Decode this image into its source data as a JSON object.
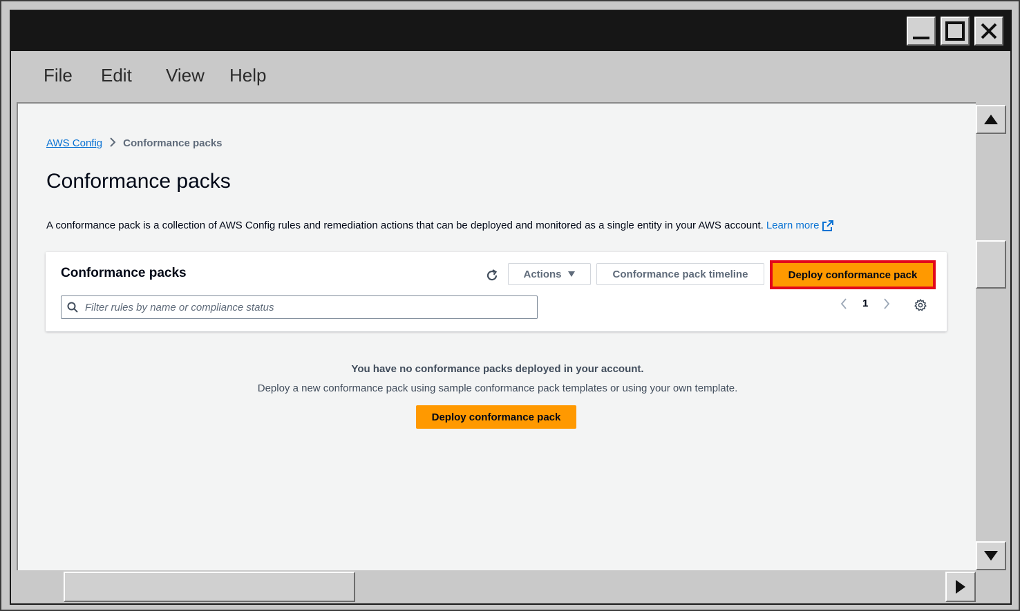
{
  "menu": {
    "items": [
      {
        "label": "File"
      },
      {
        "label": "Edit"
      },
      {
        "label": "View"
      },
      {
        "label": "Help"
      }
    ]
  },
  "breadcrumb": {
    "root": "AWS Config",
    "current": "Conformance packs"
  },
  "page": {
    "title": "Conformance packs",
    "description": "A conformance pack is a collection of AWS Config rules and remediation actions that can be deployed and monitored as a single entity in your AWS account.",
    "learn_more": "Learn more"
  },
  "container": {
    "title": "Conformance packs",
    "actions_label": "Actions",
    "timeline_label": "Conformance pack timeline",
    "deploy_label": "Deploy conformance pack",
    "search_placeholder": "Filter rules by name or compliance status",
    "page_number": "1"
  },
  "empty_state": {
    "title": "You have no conformance packs deployed in your account.",
    "description": "Deploy a new conformance pack using sample conformance pack templates or using your own template.",
    "button_label": "Deploy conformance pack"
  },
  "colors": {
    "primary": "#ff9900",
    "link": "#0972d3",
    "highlight": "#e3071b"
  }
}
